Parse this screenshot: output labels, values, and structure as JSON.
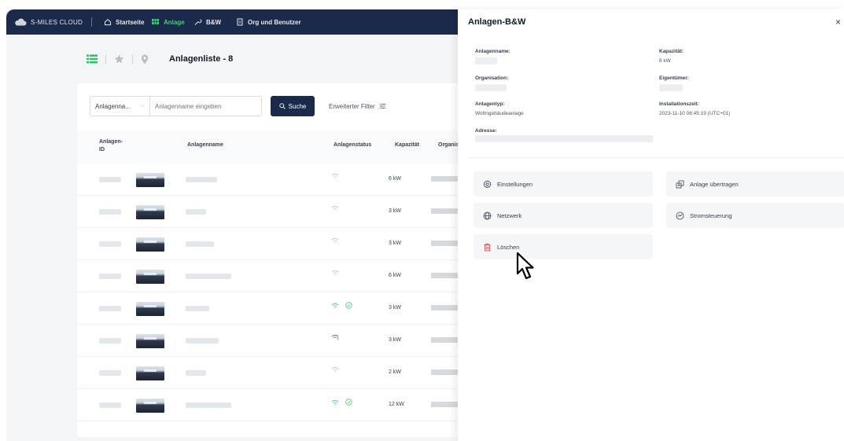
{
  "nav": {
    "brand": "S-MILES CLOUD",
    "items": [
      {
        "label": "Startseite"
      },
      {
        "label": "Anlage"
      },
      {
        "label": "B&W"
      },
      {
        "label": "Org und Benutzer"
      }
    ]
  },
  "toolbar": {
    "title": "Anlagenliste - 8"
  },
  "search": {
    "dropdown_value": "Anlagenna...",
    "placeholder": "Anlagenname eingeben",
    "button_label": "Suche",
    "filter_label": "Erweiterter Filter"
  },
  "table": {
    "headers": {
      "id": "Anlagen-\nID",
      "name": "Anlagenname",
      "status": "Anlagenstatus",
      "capacity": "Kapazität",
      "org": "Organisa"
    },
    "rows": [
      {
        "capacity": "6 kW"
      },
      {
        "capacity": "3 kW"
      },
      {
        "capacity": "3 kW"
      },
      {
        "capacity": "6 kW"
      },
      {
        "capacity": "3 kW"
      },
      {
        "capacity": "3 kW"
      },
      {
        "capacity": "2 kW"
      },
      {
        "capacity": "12 kW"
      }
    ]
  },
  "panel": {
    "title": "Anlagen-B&W",
    "close": "×",
    "fields": {
      "name_label": "Anlagenname:",
      "capacity_label": "Kapazität:",
      "capacity_value": "6 kW",
      "org_label": "Organisation:",
      "owner_label": "Eigentümer:",
      "type_label": "Anlagentyp:",
      "type_value": "Wohngebäudeanlage",
      "install_label": "Installationszeit:",
      "install_value": "2023-11-10 06:45:19 (UTC+01)",
      "address_label": "Adresse:"
    },
    "actions": {
      "settings": "Einstellungen",
      "transfer": "Anlage übertragen",
      "network": "Netzwerk",
      "power": "Stromsteuerung",
      "delete": "Löschen"
    }
  },
  "colors": {
    "nav_bg": "#1b2a4a",
    "accent_green": "#3fd07a",
    "delete_red": "#e5484d"
  }
}
